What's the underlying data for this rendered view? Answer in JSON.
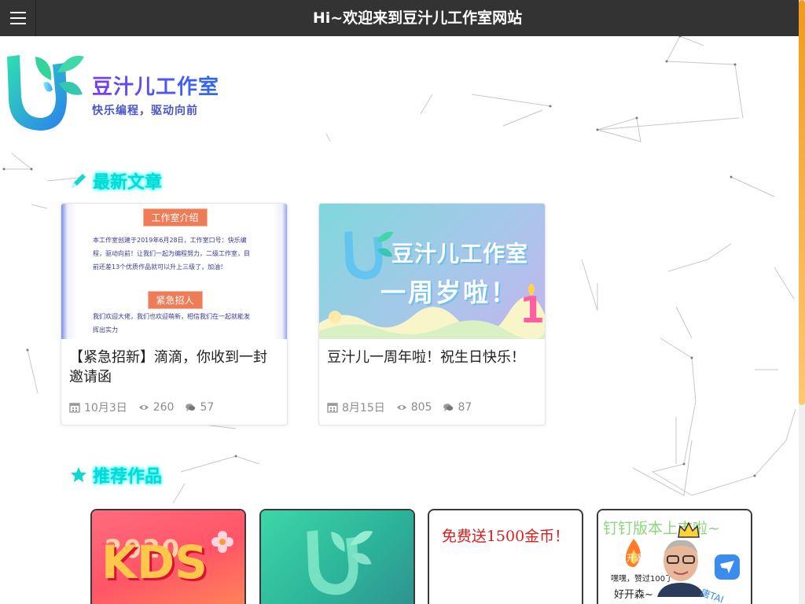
{
  "header": {
    "title": "Hi~欢迎来到豆汁儿工作室网站",
    "menu_icon": "hamburger-menu-icon"
  },
  "logo": {
    "name": "豆汁儿工作室",
    "slogan": "快乐编程，驱动向前"
  },
  "sections": {
    "latest": {
      "title": "最新文章",
      "icon": "pencil-icon"
    },
    "recommended": {
      "title": "推荐作品",
      "icon": "star-icon"
    }
  },
  "articles": [
    {
      "title": "【紧急招新】滴滴，你收到一封邀请函",
      "date": "10月3日",
      "views": "260",
      "comments": "57",
      "image": {
        "tag1": "工作室介绍",
        "text1": "本工作室创建于2019年6月28日，工作室口号：快乐编程，驱动向前！让我们一起为编程努力，二级工作室，目前还差13个优质作品就可以升上三级了，加油！",
        "tag2": "紧急招人",
        "text2": "我们欢迎大佬，我们也欢迎萌新，相信我们在一起就能发挥出实力"
      }
    },
    {
      "title": "豆汁儿一周年啦！祝生日快乐！",
      "date": "8月15日",
      "views": "805",
      "comments": "87",
      "image": {
        "line1": "豆汁儿工作室",
        "line2": "一周岁啦！",
        "candle_number": "1"
      }
    }
  ],
  "works": [
    {
      "year": "2020",
      "letters": "KDS"
    },
    {
      "logo": "豆汁儿 logo"
    },
    {
      "text": "免费送1500金币！"
    },
    {
      "top": "钉钉版本上市啦~",
      "badge": "开源",
      "note1": "嘿嘿，赞过100了",
      "note2": "好开森~",
      "tag": "唐TAI"
    }
  ],
  "colors": {
    "topbar": "#333333",
    "neon": "#0fd6cf",
    "scroll": "#f29a19"
  }
}
